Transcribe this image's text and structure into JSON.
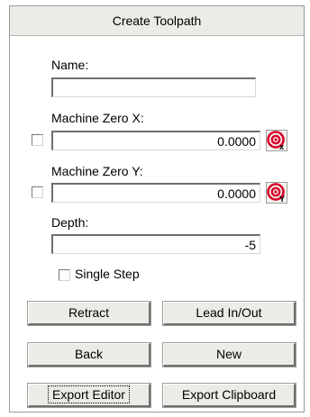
{
  "window": {
    "title": "Create Toolpath"
  },
  "name": {
    "label": "Name:",
    "value": ""
  },
  "machine_zero_x": {
    "label": "Machine Zero X:",
    "value": "0.0000",
    "checked": false,
    "icon": "target-x-icon",
    "icon_letter": "x"
  },
  "machine_zero_y": {
    "label": "Machine Zero Y:",
    "value": "0.0000",
    "checked": false,
    "icon": "target-y-icon",
    "icon_letter": "Y"
  },
  "depth": {
    "label": "Depth:",
    "value": "-5"
  },
  "single_step": {
    "label": "Single Step",
    "checked": false
  },
  "buttons": {
    "retract": "Retract",
    "lead_in_out": "Lead In/Out",
    "back": "Back",
    "new": "New",
    "export_editor": "Export Editor",
    "export_clipboard": "Export Clipboard"
  },
  "colors": {
    "panel_bg": "#ecebe6",
    "icon_red": "#d9002a"
  }
}
